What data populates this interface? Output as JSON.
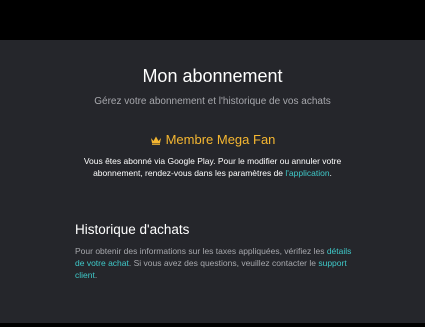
{
  "header": {
    "title": "Mon abonnement",
    "subtitle": "Gérez votre abonnement et l'historique de vos achats"
  },
  "membership": {
    "icon": "crown-icon",
    "label": "Membre Mega Fan",
    "desc_before": "Vous êtes abonné via Google Play. Pour le modifier ou annuler votre abonnement, rendez-vous dans les paramètres de ",
    "desc_link": "l'application",
    "desc_after": "."
  },
  "history": {
    "title": "Historique d'achats",
    "desc_part1": "Pour obtenir des informations sur les taxes appliquées, vérifiez les ",
    "link1": "détails de votre achat",
    "desc_part2": ". Si vous avez des questions, veuillez contacter le ",
    "link2": "support client",
    "desc_part3": "."
  },
  "colors": {
    "background": "#25262b",
    "accent_gold": "#f5b731",
    "link_teal": "#3fc9c9",
    "muted_text": "#a7a8ad"
  }
}
